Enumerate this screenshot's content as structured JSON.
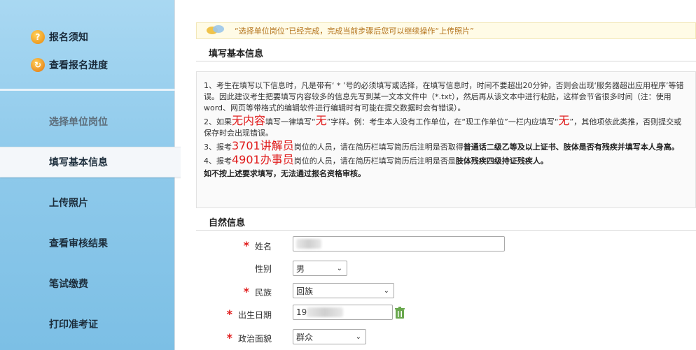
{
  "sidebar": {
    "top_links": [
      {
        "label": "报名须知",
        "icon": "info-icon"
      },
      {
        "label": "查看报名进度",
        "icon": "progress-icon"
      }
    ],
    "steps": [
      {
        "label": "选择单位岗位",
        "state": "disabled"
      },
      {
        "label": "填写基本信息",
        "state": "active"
      },
      {
        "label": "上传照片",
        "state": "normal"
      },
      {
        "label": "查看审核结果",
        "state": "normal"
      },
      {
        "label": "笔试缴费",
        "state": "normal"
      },
      {
        "label": "打印准考证",
        "state": "normal"
      }
    ]
  },
  "notice": {
    "text": "“选择单位岗位”已经完成，完成当前步骤后您可以继续操作“上传照片”"
  },
  "basic_info_title": "填写基本信息",
  "rules": {
    "r1": "1、考生在填写以下信息时，凡是带有‘ * ’号的必须填写或选择，在填写信息时，时间不要超出20分钟，否则会出现‘服务器超出应用程序’等错误。因此建议考生把要填写内容较多的信息先写到某一文本文件中（*.txt），然后再从该文本中进行粘贴，这样会节省很多时间（注：使用word、网页等带格式的编辑软件进行编辑时有可能在提交数据时会有错误）。",
    "r2_a": "2、如果",
    "r2_big1": "无内容",
    "r2_b": "填写一律填写“",
    "r2_big2": "无",
    "r2_c": "”字样。例：考生本人没有工作单位，在“现工作单位”一栏内应填写“",
    "r2_big3": "无",
    "r2_d": "”，其他项依此类推，否则提交或保存时会出现错误。",
    "r3_a": "3、报考",
    "r3_big": "3701讲解员",
    "r3_b": "岗位的人员，请在简历栏填写简历后注明是否取得",
    "r3_bold": "普通话二级乙等及以上证书、肢体是否有残疾并填写本人身高。",
    "r4_a": "4、报考",
    "r4_big": "4901办事员",
    "r4_b": "岗位的人员，请在简历栏填写简历后注明是否是",
    "r4_bold": "肢体残疾四级持证残疾人。",
    "r5_bold": "如不按上述要求填写，无法通过报名资格审核。"
  },
  "natural_info_title": "自然信息",
  "form": {
    "name": {
      "label": "姓名",
      "required": true,
      "value": ""
    },
    "gender": {
      "label": "性别",
      "required": false,
      "value": "男"
    },
    "ethnicity": {
      "label": "民族",
      "required": true,
      "value": "回族"
    },
    "birthdate": {
      "label": "出生日期",
      "required": true,
      "value": "19"
    },
    "political": {
      "label": "政治面貌",
      "required": true,
      "value": "群众"
    }
  },
  "colors": {
    "required_star": "#e01b1b",
    "notice_text": "#b3721a",
    "sidebar_bg": "#8fcaeb"
  }
}
